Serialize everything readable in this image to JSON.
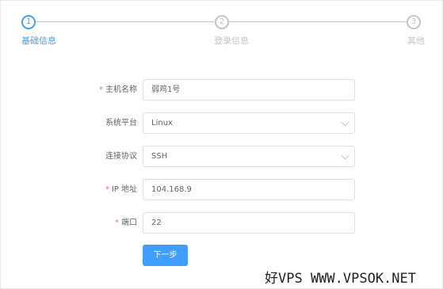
{
  "steps": [
    {
      "num": "1",
      "title": "基础信息"
    },
    {
      "num": "2",
      "title": "登录信息"
    },
    {
      "num": "3",
      "title": "其他"
    }
  ],
  "form": {
    "hostname": {
      "label": "主机名称",
      "required": "*",
      "value": "弱鸡1号"
    },
    "platform": {
      "label": "系统平台",
      "value": "Linux"
    },
    "protocol": {
      "label": "连接协议",
      "value": "SSH"
    },
    "ip": {
      "label": "IP 地址",
      "required": "*",
      "value": "104.168.9"
    },
    "port": {
      "label": "端口",
      "required": "*",
      "value": "22"
    }
  },
  "next_button": "下一步",
  "watermark": "好VPS WWW.VPSOK.NET",
  "colors": {
    "accent": "#409eff",
    "required": "#f56c6c",
    "muted": "#c0c4cc"
  }
}
